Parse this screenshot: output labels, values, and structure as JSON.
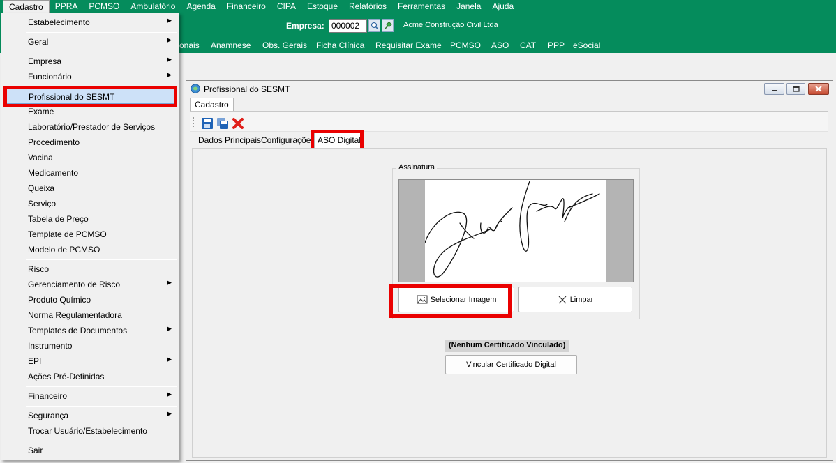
{
  "menubar": {
    "items": [
      "Cadastro",
      "PPRA",
      "PCMSO",
      "Ambulatório",
      "Agenda",
      "Financeiro",
      "CIPA",
      "Estoque",
      "Relatórios",
      "Ferramentas",
      "Janela",
      "Ajuda"
    ]
  },
  "empresa": {
    "label": "Empresa:",
    "code": "000002",
    "name": "Acme Construção Civil Ltda",
    "search_icon": "magnifier-icon",
    "pin_icon": "pin-icon"
  },
  "nav": {
    "items": [
      "onais",
      "Anamnese",
      "Obs. Gerais",
      "Ficha Clínica",
      "Requisitar Exame",
      "PCMSO",
      "ASO",
      "CAT",
      "PPP",
      "eSocial"
    ]
  },
  "dropdown": {
    "items": [
      {
        "label": "Estabelecimento",
        "submenu": true
      },
      {
        "label": "Geral",
        "submenu": true
      },
      {
        "label": "Empresa",
        "submenu": true
      },
      {
        "label": "Funcionário",
        "submenu": true
      },
      {
        "label": "Profissional do SESMT",
        "submenu": false,
        "highlighted": true
      },
      {
        "label": "Exame",
        "submenu": false
      },
      {
        "label": "Laboratório/Prestador de Serviços",
        "submenu": false
      },
      {
        "label": "Procedimento",
        "submenu": false
      },
      {
        "label": "Vacina",
        "submenu": false
      },
      {
        "label": "Medicamento",
        "submenu": false
      },
      {
        "label": "Queixa",
        "submenu": false
      },
      {
        "label": "Serviço",
        "submenu": false
      },
      {
        "label": "Tabela de Preço",
        "submenu": false
      },
      {
        "label": "Template de PCMSO",
        "submenu": false
      },
      {
        "label": "Modelo de PCMSO",
        "submenu": false
      },
      {
        "label": "Risco",
        "submenu": false
      },
      {
        "label": "Gerenciamento de Risco",
        "submenu": true
      },
      {
        "label": "Produto Químico",
        "submenu": false
      },
      {
        "label": "Norma Regulamentadora",
        "submenu": false
      },
      {
        "label": "Templates de Documentos",
        "submenu": true
      },
      {
        "label": "Instrumento",
        "submenu": false
      },
      {
        "label": "EPI",
        "submenu": true
      },
      {
        "label": "Ações Pré-Definidas",
        "submenu": false
      },
      {
        "label": "Financeiro",
        "submenu": true
      },
      {
        "label": "Segurança",
        "submenu": true
      },
      {
        "label": "Trocar Usuário/Estabelecimento",
        "submenu": false
      },
      {
        "label": "Sair",
        "submenu": false
      }
    ]
  },
  "window": {
    "title": "Profissional do SESMT",
    "outer_tab": "Cadastro",
    "toolbar_icons": [
      "save-icon",
      "save-copy-icon",
      "delete-icon"
    ],
    "tabs": [
      "Dados Principais",
      "Configurações",
      "ASO Digital"
    ],
    "active_tab": "ASO Digital",
    "signature_group_label": "Assinatura",
    "select_image_label": "Selecionar Imagem",
    "clear_label": "Limpar",
    "certificate_status": "(Nenhum Certificado Vinculado)",
    "link_certificate_label": "Vincular Certificado Digital"
  },
  "colors": {
    "menubar_green": "#058c5c",
    "highlight_red": "#ea0000",
    "menu_highlight": "#cde1f8"
  }
}
